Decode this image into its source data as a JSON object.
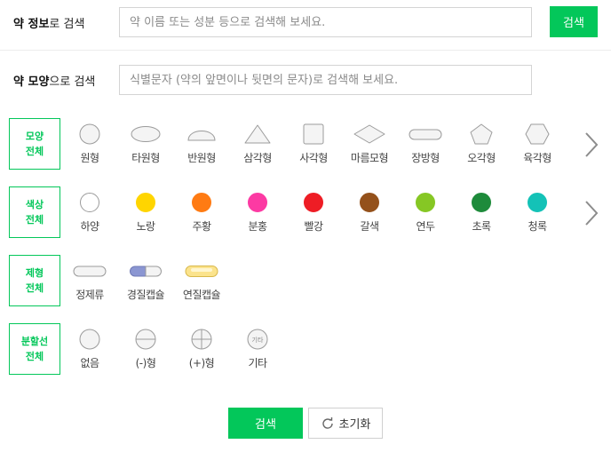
{
  "info_search": {
    "label_bold": "약 정보",
    "label_rest": "로 검색",
    "placeholder": "약 이름 또는 성분 등으로 검색해 보세요.",
    "button": "검색"
  },
  "mark_search": {
    "label_bold": "약 모양",
    "label_rest": "으로 검색",
    "placeholder": "식별문자 (약의 앞면이나 뒷면의 문자)로 검색해 보세요."
  },
  "shape_filter": {
    "title_line1": "모양",
    "title_line2": "전체",
    "options": [
      {
        "label": "원형",
        "icon": "circle-shape-icon"
      },
      {
        "label": "타원형",
        "icon": "oval-shape-icon"
      },
      {
        "label": "반원형",
        "icon": "semicircle-shape-icon"
      },
      {
        "label": "삼각형",
        "icon": "triangle-shape-icon"
      },
      {
        "label": "사각형",
        "icon": "square-shape-icon"
      },
      {
        "label": "마름모형",
        "icon": "diamond-shape-icon"
      },
      {
        "label": "장방형",
        "icon": "rectangle-shape-icon"
      },
      {
        "label": "오각형",
        "icon": "pentagon-shape-icon"
      },
      {
        "label": "육각형",
        "icon": "hexagon-shape-icon"
      }
    ]
  },
  "color_filter": {
    "title_line1": "색상",
    "title_line2": "전체",
    "options": [
      {
        "label": "하양",
        "color": "#ffffff"
      },
      {
        "label": "노랑",
        "color": "#ffd500"
      },
      {
        "label": "주황",
        "color": "#ff7b13"
      },
      {
        "label": "분홍",
        "color": "#fc3aa3"
      },
      {
        "label": "빨강",
        "color": "#ee1d25"
      },
      {
        "label": "갈색",
        "color": "#94511b"
      },
      {
        "label": "연두",
        "color": "#86c724"
      },
      {
        "label": "초록",
        "color": "#1e8b3b"
      },
      {
        "label": "청록",
        "color": "#14c2b7"
      }
    ]
  },
  "form_filter": {
    "title_line1": "제형",
    "title_line2": "전체",
    "options": [
      {
        "label": "정제류",
        "icon": "tablet-icon"
      },
      {
        "label": "경질캡슐",
        "icon": "hard-capsule-icon"
      },
      {
        "label": "연질캡슐",
        "icon": "soft-capsule-icon"
      }
    ]
  },
  "score_filter": {
    "title_line1": "분할선",
    "title_line2": "전체",
    "options": [
      {
        "label": "없음",
        "icon": "no-line-icon"
      },
      {
        "label": "(-)형",
        "icon": "minus-line-icon"
      },
      {
        "label": "(+)형",
        "icon": "plus-line-icon"
      },
      {
        "label": "기타",
        "icon": "other-line-icon",
        "icon_text": "기타"
      }
    ]
  },
  "actions": {
    "search": "검색",
    "reset": "초기화"
  }
}
